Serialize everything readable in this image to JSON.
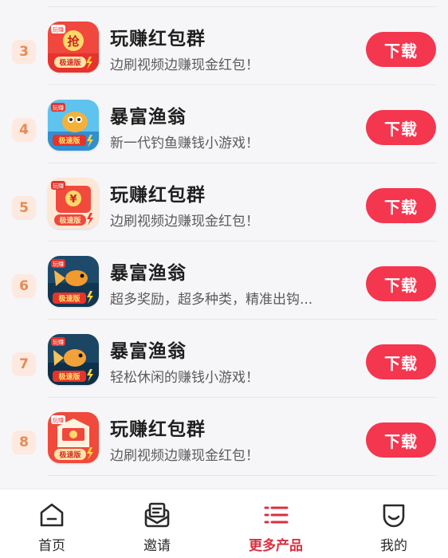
{
  "apps": [
    {
      "rank": "3",
      "name": "玩赚红包群",
      "desc": "边刷视频边赚现金红包！",
      "button": "下载",
      "icon": "red-envelope-grab-icon",
      "icon_badge": "玩赚",
      "icon_text": "抢",
      "icon_tag": "极速版"
    },
    {
      "rank": "4",
      "name": "暴富渔翁",
      "desc": "新一代钓鱼赚钱小游戏！",
      "button": "下载",
      "icon": "fish-cartoon-icon",
      "icon_badge": "玩赚",
      "icon_tag": "极速版"
    },
    {
      "rank": "5",
      "name": "玩赚红包群",
      "desc": "边刷视频边赚现金红包！",
      "button": "下载",
      "icon": "red-envelope-yuan-icon",
      "icon_badge": "玩赚",
      "icon_text": "¥",
      "icon_tag": "极速版"
    },
    {
      "rank": "6",
      "name": "暴富渔翁",
      "desc": "超多奖励，超多种类，精准出钩...",
      "button": "下载",
      "icon": "goldfish-icon",
      "icon_badge": "玩赚",
      "icon_tag": "极速版"
    },
    {
      "rank": "7",
      "name": "暴富渔翁",
      "desc": "轻松休闲的赚钱小游戏！",
      "button": "下载",
      "icon": "goldfish-icon",
      "icon_badge": "玩赚",
      "icon_tag": "极速版"
    },
    {
      "rank": "8",
      "name": "玩赚红包群",
      "desc": "边刷视频边赚现金红包！",
      "button": "下载",
      "icon": "red-envelope-open-icon",
      "icon_badge": "玩赚",
      "icon_tag": "极速版"
    }
  ],
  "tabbar": {
    "items": [
      {
        "label": "首页",
        "icon": "home-icon",
        "active": false
      },
      {
        "label": "邀请",
        "icon": "invite-envelope-icon",
        "active": false
      },
      {
        "label": "更多产品",
        "icon": "list-menu-icon",
        "active": true
      },
      {
        "label": "我的",
        "icon": "smile-face-icon",
        "active": false
      }
    ]
  },
  "colors": {
    "button": "#f4364f",
    "rank_bg": "#fde9df",
    "rank_text": "#e78a52",
    "active_tab": "#d9303f"
  }
}
